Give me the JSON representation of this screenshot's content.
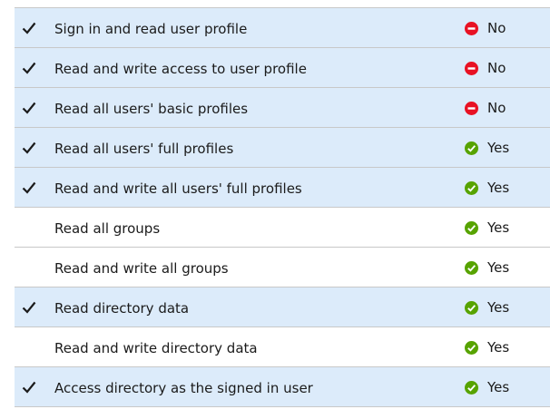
{
  "permissions": [
    {
      "label": "Sign in and read user profile",
      "checked": true,
      "admin_consent": "No"
    },
    {
      "label": "Read and write access to user profile",
      "checked": true,
      "admin_consent": "No"
    },
    {
      "label": "Read all users' basic profiles",
      "checked": true,
      "admin_consent": "No"
    },
    {
      "label": "Read all users' full profiles",
      "checked": true,
      "admin_consent": "Yes"
    },
    {
      "label": "Read and write all users' full profiles",
      "checked": true,
      "admin_consent": "Yes"
    },
    {
      "label": "Read all groups",
      "checked": false,
      "admin_consent": "Yes"
    },
    {
      "label": "Read and write all groups",
      "checked": false,
      "admin_consent": "Yes"
    },
    {
      "label": "Read directory data",
      "checked": true,
      "admin_consent": "Yes"
    },
    {
      "label": "Read and write directory data",
      "checked": false,
      "admin_consent": "Yes"
    },
    {
      "label": "Access directory as the signed in user",
      "checked": true,
      "admin_consent": "Yes"
    }
  ],
  "colors": {
    "selected_row": "#dcebfa",
    "no_icon": "#e81123",
    "yes_icon": "#57a300"
  },
  "icons": {
    "checkmark": "checkmark-icon",
    "no": "blocked-icon",
    "yes": "check-circle-icon"
  }
}
